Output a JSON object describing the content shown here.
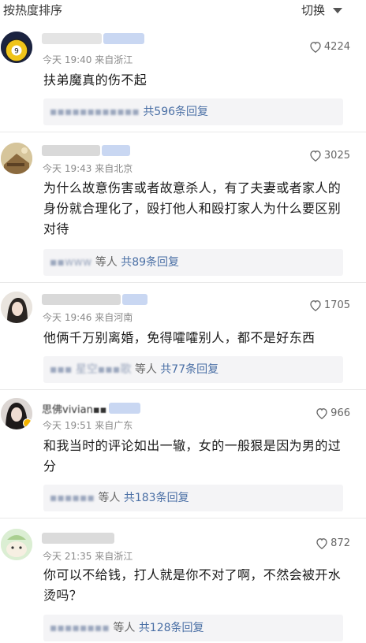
{
  "header": {
    "sort_label": "按热度排序",
    "switch_label": "切换"
  },
  "comments": [
    {
      "username": "▪▪▪▪▪▪▪▪▪▪",
      "avatar_badge": "9",
      "meta": "今天 19:40 来自浙江",
      "likes": "4224",
      "text": "扶弟魔真的伤不起",
      "reply_names": "▪▪▪▪▪▪▪▪▪▪▪▪",
      "reply_others": "",
      "reply_count": "共596条回复"
    },
    {
      "username": "▪▪▪▪▪▪▪▪",
      "meta": "今天 19:43 来自北京",
      "likes": "3025",
      "text": "为什么故意伤害或者故意杀人，有了夫妻或者家人的身份就合理化了，殴打他人和殴打家人为什么要区别对待",
      "reply_names": "▪▪www",
      "reply_others": "等人",
      "reply_count": "共89条回复"
    },
    {
      "username": "▪▪▪▪▪▪▪▪▪▪",
      "meta": "今天 19:46 来自河南",
      "likes": "1705",
      "text": "他俩千万别离婚，免得嚯嚯别人，都不是好东西",
      "reply_names": "▪▪▪ 星空▪▪▪歌",
      "reply_others": "等人",
      "reply_count": "共77条回复"
    },
    {
      "username": "思佛vivian▪▪",
      "meta": "今天 19:51 来自广东",
      "likes": "966",
      "text": "和我当时的评论如出一辙，女的一般狠是因为男的过分",
      "reply_names": "▪▪▪▪▪▪",
      "reply_others": "等人",
      "reply_count": "共183条回复"
    },
    {
      "username": "▪▪▪▪▪▪▪▪▪",
      "meta": "今天 21:35 来自浙江",
      "likes": "872",
      "text": "你可以不给钱，打人就是你不对了啊，不然会被开水烫吗？",
      "reply_names": "▪▪▪▪▪▪▪▪",
      "reply_others": "等人",
      "reply_count": "共128条回复"
    }
  ],
  "colors": {
    "reply_count": "#4a6fa5",
    "reply_bg": "#f4f4f6",
    "meta": "#8a8a8a",
    "username_blur": "#c9d7f2"
  }
}
